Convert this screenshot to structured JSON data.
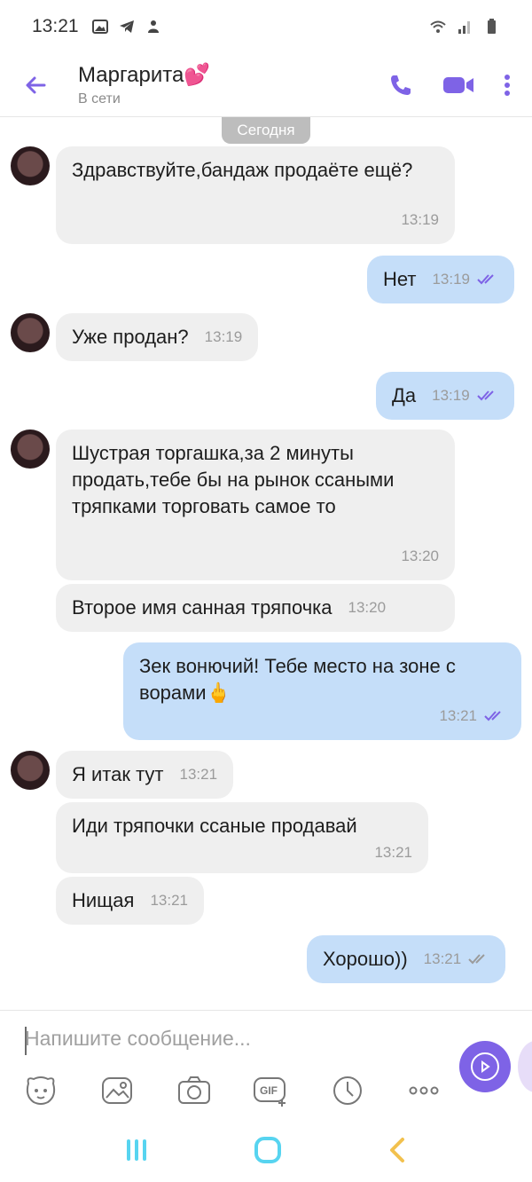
{
  "status_bar": {
    "time": "13:21"
  },
  "header": {
    "contact_name": "Маргарита💕",
    "contact_status": "В сети",
    "accent": "#7e63e6"
  },
  "chat": {
    "date_chip": "Сегодня",
    "messages": [
      {
        "dir": "in",
        "text": "Здравствуйте,бандаж продаёте ещё?",
        "time": "13:19"
      },
      {
        "dir": "out",
        "text": "Нет",
        "time": "13:19"
      },
      {
        "dir": "in",
        "text": "Уже продан?",
        "time": "13:19"
      },
      {
        "dir": "out",
        "text": "Да",
        "time": "13:19"
      },
      {
        "dir": "in",
        "text": "Шустрая торгашка,за 2 минуты продать,тебе бы на рынок ссаными тряпками торговать самое то",
        "time": "13:20"
      },
      {
        "dir": "in",
        "text": "Второе имя санная тряпочка",
        "time": "13:20"
      },
      {
        "dir": "out",
        "text": "Зек вонючий! Тебе место на зоне с ворами🖕",
        "time": "13:21"
      },
      {
        "dir": "in",
        "text": "Я итак тут",
        "time": "13:21"
      },
      {
        "dir": "in",
        "text": "Иди тряпочки ссаные продавай",
        "time": "13:21"
      },
      {
        "dir": "in",
        "text": "Нищая",
        "time": "13:21"
      },
      {
        "dir": "out",
        "text": "Хорошо))",
        "time": "13:21"
      }
    ]
  },
  "composer": {
    "placeholder": "Напишите сообщение...",
    "tools": [
      "sticker-icon",
      "gallery-icon",
      "camera-icon",
      "gif-icon",
      "timer-icon",
      "more-icon"
    ]
  }
}
